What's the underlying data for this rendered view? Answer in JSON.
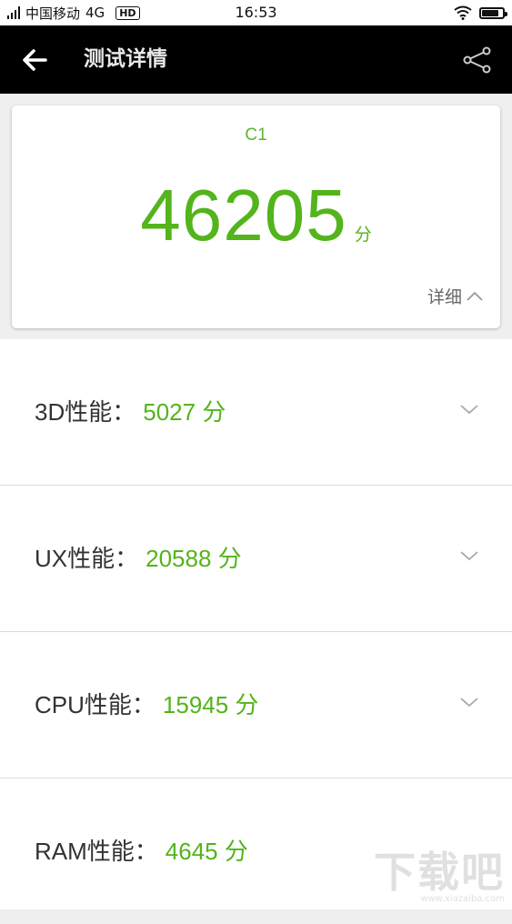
{
  "status_bar": {
    "carrier": "中国移动",
    "network": "4G",
    "hd_badge": "HD",
    "time": "16:53",
    "battery_level": 0.9
  },
  "header": {
    "title": "测试详情",
    "back_icon": "arrow-left-icon",
    "share_icon": "share-icon"
  },
  "score_card": {
    "device": "C1",
    "total_score": "46205",
    "unit": "分",
    "detail_label": "详细"
  },
  "categories": [
    {
      "label": "3D性能：",
      "value": "5027 分"
    },
    {
      "label": "UX性能：",
      "value": "20588 分"
    },
    {
      "label": "CPU性能：",
      "value": "15945 分"
    },
    {
      "label": "RAM性能：",
      "value": "4645 分"
    }
  ],
  "watermark": {
    "text": "下载吧",
    "url": "www.xiazaiba.com"
  },
  "colors": {
    "accent_green": "#53b41b",
    "header_bg": "#000000"
  }
}
